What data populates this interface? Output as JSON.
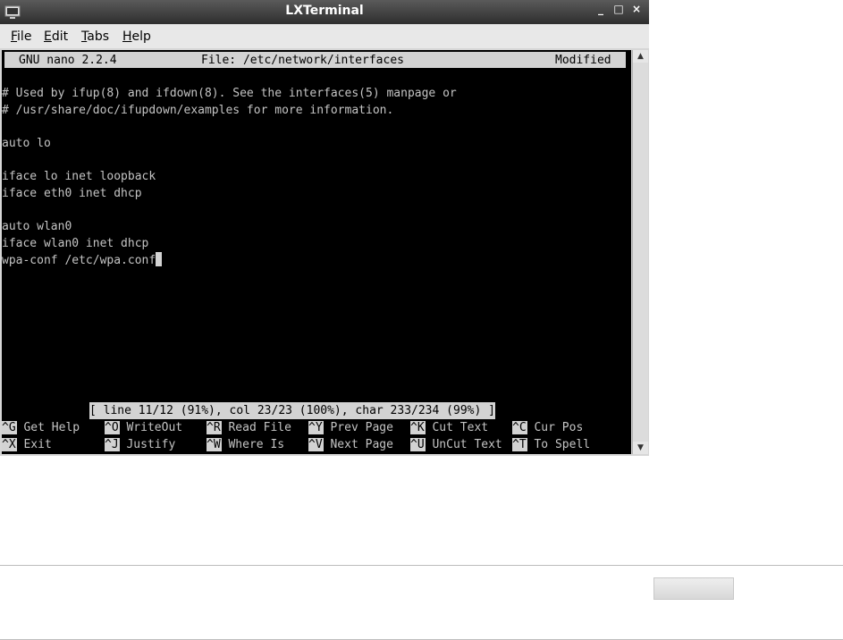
{
  "window": {
    "title": "LXTerminal",
    "controls": [
      "_",
      "□",
      "×"
    ]
  },
  "menubar": {
    "items": [
      {
        "mnemonic": "F",
        "rest": "ile"
      },
      {
        "mnemonic": "E",
        "rest": "dit"
      },
      {
        "mnemonic": "T",
        "rest": "abs"
      },
      {
        "mnemonic": "H",
        "rest": "elp"
      }
    ]
  },
  "nano": {
    "version": "GNU nano 2.2.4",
    "file": "File: /etc/network/interfaces",
    "state": "Modified",
    "lines": [
      "",
      "# Used by ifup(8) and ifdown(8). See the interfaces(5) manpage or",
      "# /usr/share/doc/ifupdown/examples for more information.",
      "",
      "auto lo",
      "",
      "iface lo inet loopback",
      "iface eth0 inet dhcp",
      "",
      "auto wlan0",
      "iface wlan0 inet dhcp",
      "wpa-conf /etc/wpa.conf"
    ],
    "status": "[ line 11/12 (91%), col 23/23 (100%), char 233/234 (99%) ]",
    "shortcuts_row1": [
      {
        "key": "^G",
        "label": " Get Help"
      },
      {
        "key": "^O",
        "label": " WriteOut"
      },
      {
        "key": "^R",
        "label": " Read File"
      },
      {
        "key": "^Y",
        "label": " Prev Page"
      },
      {
        "key": "^K",
        "label": " Cut Text"
      },
      {
        "key": "^C",
        "label": " Cur Pos"
      }
    ],
    "shortcuts_row2": [
      {
        "key": "^X",
        "label": " Exit"
      },
      {
        "key": "^J",
        "label": " Justify"
      },
      {
        "key": "^W",
        "label": " Where Is"
      },
      {
        "key": "^V",
        "label": " Next Page"
      },
      {
        "key": "^U",
        "label": " UnCut Text"
      },
      {
        "key": "^T",
        "label": " To Spell"
      }
    ]
  },
  "scrollbar": {
    "up_icon": "triangle-up",
    "down_icon": "triangle-down"
  }
}
